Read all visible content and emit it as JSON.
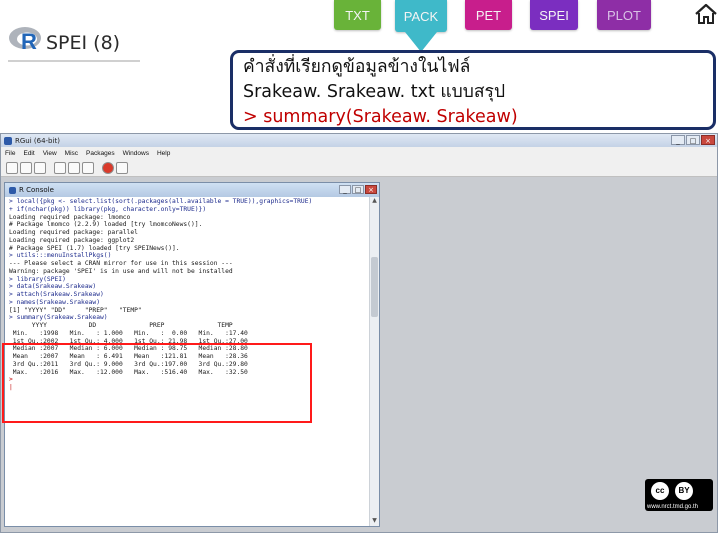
{
  "nav": {
    "tabs": [
      {
        "label": "TXT",
        "color": "#69b339"
      },
      {
        "label": "PACK",
        "color": "#3fb9c9",
        "active": true
      },
      {
        "label": "PET",
        "color": "#c81e8c"
      },
      {
        "label": "SPEI",
        "color": "#7b2ec0"
      },
      {
        "label": "PLOT",
        "color": "#8e2ea6"
      }
    ],
    "home_icon": "home-icon"
  },
  "header": {
    "logo_icon": "r-logo-icon",
    "title": "SPEI (8)"
  },
  "instruction": {
    "line1": "คำสั่งที่เรียกดูข้อมูลข้างในไฟล์",
    "line2": "Srakeaw. Srakeaw. txt แบบสรุป",
    "command": "> summary(Srakeaw. Srakeaw)"
  },
  "rgui": {
    "title": "RGui (64-bit)",
    "menu": [
      "File",
      "Edit",
      "View",
      "Misc",
      "Packages",
      "Windows",
      "Help"
    ],
    "controls": [
      "_",
      "□",
      "×"
    ],
    "console": {
      "title": "R Console",
      "controls": [
        "_",
        "□",
        "×"
      ],
      "lines": [
        {
          "t": "> local({pkg <- select.list(sort(.packages(all.available = TRUE)),graphics=TRUE)",
          "c": "in"
        },
        {
          "t": "+ if(nchar(pkg)) library(pkg, character.only=TRUE)})",
          "c": "in"
        },
        {
          "t": "Loading required package: lmomco",
          "c": "out"
        },
        {
          "t": "# Package lmomco (2.2.9) loaded [try lmomcoNews()].",
          "c": "out"
        },
        {
          "t": "Loading required package: parallel",
          "c": "out"
        },
        {
          "t": "Loading required package: ggplot2",
          "c": "out"
        },
        {
          "t": "# Package SPEI (1.7) loaded [try SPEINews()].",
          "c": "out"
        },
        {
          "t": "> utils:::menuInstallPkgs()",
          "c": "in"
        },
        {
          "t": "--- Please select a CRAN mirror for use in this session ---",
          "c": "out"
        },
        {
          "t": "Warning: package 'SPEI' is in use and will not be installed",
          "c": "out"
        },
        {
          "t": "> library(SPEI)",
          "c": "in"
        },
        {
          "t": "> data(Srakeaw.Srakeaw)",
          "c": "in"
        },
        {
          "t": "> attach(Srakeaw.Srakeaw)",
          "c": "in"
        },
        {
          "t": "> names(Srakeaw.Srakeaw)",
          "c": "in"
        },
        {
          "t": "[1] \"YYYY\" \"DD\"     \"PREP\"   \"TEMP\"",
          "c": "out"
        },
        {
          "t": "> summary(Srakeaw.Srakeaw)",
          "c": "in"
        },
        {
          "t": "      YYYY           DD              PREP              TEMP",
          "c": "out"
        },
        {
          "t": " Min.   :1998   Min.   : 1.000   Min.   :  0.00   Min.   :17.40",
          "c": "out"
        },
        {
          "t": " 1st Qu.:2002   1st Qu.: 4.000   1st Qu.: 21.98   1st Qu.:27.00",
          "c": "out"
        },
        {
          "t": " Median :2007   Median : 6.000   Median : 98.75   Median :28.80",
          "c": "out"
        },
        {
          "t": " Mean   :2007   Mean   : 6.491   Mean   :121.81   Mean   :28.36",
          "c": "out"
        },
        {
          "t": " 3rd Qu.:2011   3rd Qu.: 9.000   3rd Qu.:197.00   3rd Qu.:29.80",
          "c": "out"
        },
        {
          "t": " Max.   :2016   Max.   :12.000   Max.   :516.40   Max.   :32.50",
          "c": "out"
        },
        {
          "t": ">",
          "c": "cmd"
        },
        {
          "t": "|",
          "c": "cmd"
        }
      ]
    }
  },
  "license": {
    "badge_icons": [
      "cc-icon",
      "by-icon"
    ],
    "cc": "cc",
    "by": "BY",
    "url": "www.nrct.tmd.go.th"
  }
}
